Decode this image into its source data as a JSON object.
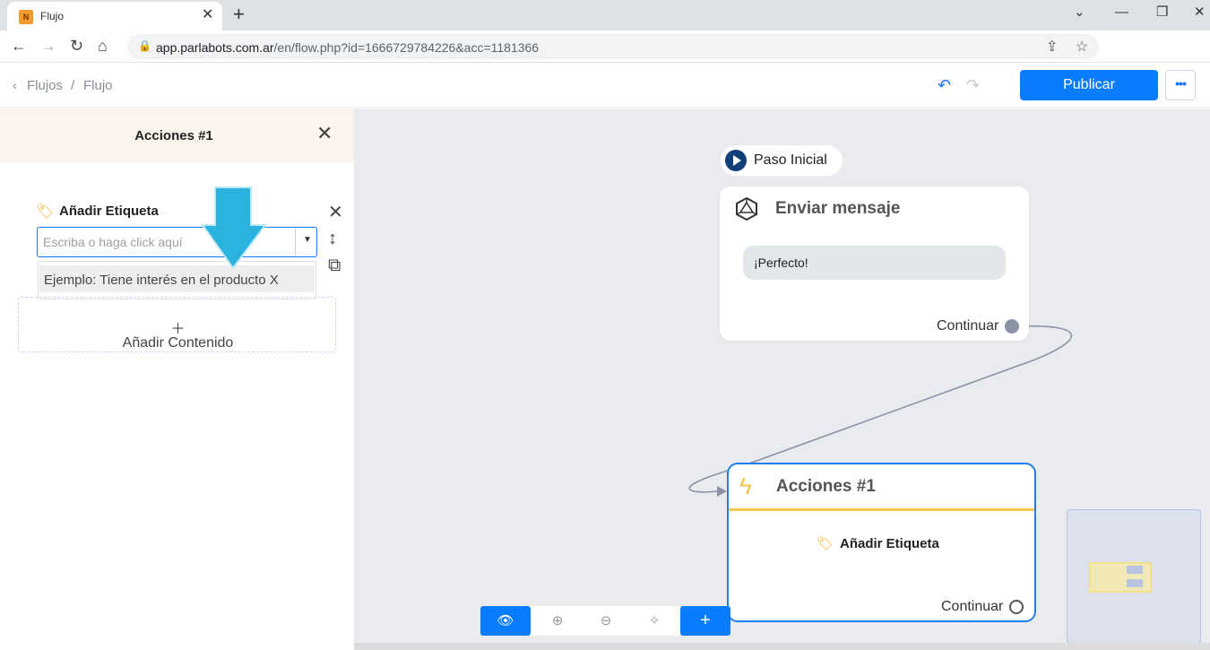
{
  "browser": {
    "tab_title": "Flujo",
    "tab_favicon_letter": "N",
    "url_host": "app.parlabots.com.ar",
    "url_path": "/en/flow.php?id=1666729784226&acc=1181366"
  },
  "header": {
    "breadcrumb_root": "Flujos",
    "breadcrumb_separator": "/",
    "breadcrumb_current": "Flujo",
    "publish_label": "Publicar"
  },
  "panel": {
    "title": "Acciones #1",
    "action_title": "Añadir Etiqueta",
    "input_value": "",
    "input_placeholder": "Escriba o haga click aquí",
    "suggestion": "Ejemplo: Tiene interés en el producto X",
    "add_content_label": "Añadir Contenido"
  },
  "canvas": {
    "start_label": "Paso Inicial",
    "message_node": {
      "title": "Enviar mensaje",
      "message": "¡Perfecto!",
      "continue_label": "Continuar"
    },
    "action_node": {
      "title": "Acciones #1",
      "action_label": "Añadir Etiqueta",
      "continue_label": "Continuar"
    }
  },
  "colors": {
    "accent": "#0a7cff",
    "panel_header_bg": "#fbf4ec",
    "canvas_bg": "#eaebee",
    "action_highlight": "#f6c94e",
    "annotation_arrow": "#2bb3e0"
  }
}
